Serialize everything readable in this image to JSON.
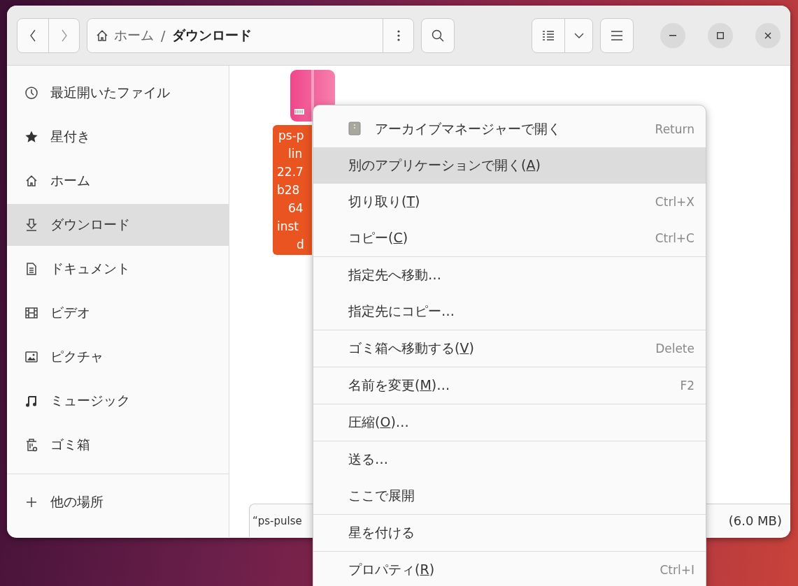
{
  "header": {
    "path": [
      {
        "kind": "home",
        "label": "ホーム",
        "current": false
      },
      {
        "kind": "folder",
        "label": "ダウンロード",
        "current": true
      }
    ],
    "path_separator": "/"
  },
  "sidebar": {
    "items": [
      {
        "kind": "recent",
        "label": "最近開いたファイル",
        "selected": false
      },
      {
        "kind": "starred",
        "label": "星付き",
        "selected": false
      },
      {
        "kind": "home",
        "label": "ホーム",
        "selected": false
      },
      {
        "kind": "download",
        "label": "ダウンロード",
        "selected": true
      },
      {
        "kind": "documents",
        "label": "ドキュメント",
        "selected": false
      },
      {
        "kind": "videos",
        "label": "ビデオ",
        "selected": false
      },
      {
        "kind": "pictures",
        "label": "ピクチャ",
        "selected": false
      },
      {
        "kind": "music",
        "label": "ミュージック",
        "selected": false
      },
      {
        "kind": "trash",
        "label": "ゴミ箱",
        "selected": false
      }
    ],
    "other_places": {
      "label": "他の場所"
    }
  },
  "file": {
    "name_lines": [
      "ps-p",
      "lin",
      "22.7",
      "b28",
      "64",
      "inst",
      "d"
    ],
    "selected": true
  },
  "status_bar": {
    "left": "“ps-pulse",
    "right": "(6.0 MB)"
  },
  "context_menu": {
    "sections": [
      [
        {
          "kind": "app",
          "before": "アーカイブマネージャーで開く",
          "shortcut": "Return",
          "selected": false
        },
        {
          "before": "別のアプリケーションで開く(",
          "key": "A",
          "after": ")",
          "selected": true
        },
        {
          "before": "切り取り(",
          "key": "T",
          "after": ")",
          "shortcut": "Ctrl+X",
          "selected": false
        },
        {
          "before": "コピー(",
          "key": "C",
          "after": ")",
          "shortcut": "Ctrl+C",
          "selected": false
        }
      ],
      [
        {
          "before": "指定先へ移動…",
          "selected": false
        },
        {
          "before": "指定先にコピー…",
          "selected": false
        }
      ],
      [
        {
          "before": "ゴミ箱へ移動する(",
          "key": "V",
          "after": ")",
          "shortcut": "Delete",
          "selected": false
        }
      ],
      [
        {
          "before": "名前を変更(",
          "key": "M",
          "after": ")…",
          "shortcut": "F2",
          "selected": false
        }
      ],
      [
        {
          "before": "圧縮(",
          "key": "O",
          "after": ")…",
          "selected": false
        }
      ],
      [
        {
          "before": "送る…",
          "selected": false
        },
        {
          "before": "ここで展開",
          "selected": false
        }
      ],
      [
        {
          "before": "星を付ける",
          "selected": false
        }
      ],
      [
        {
          "before": "プロパティ(",
          "key": "R",
          "after": ")",
          "shortcut": "Ctrl+I",
          "selected": false
        }
      ]
    ]
  }
}
